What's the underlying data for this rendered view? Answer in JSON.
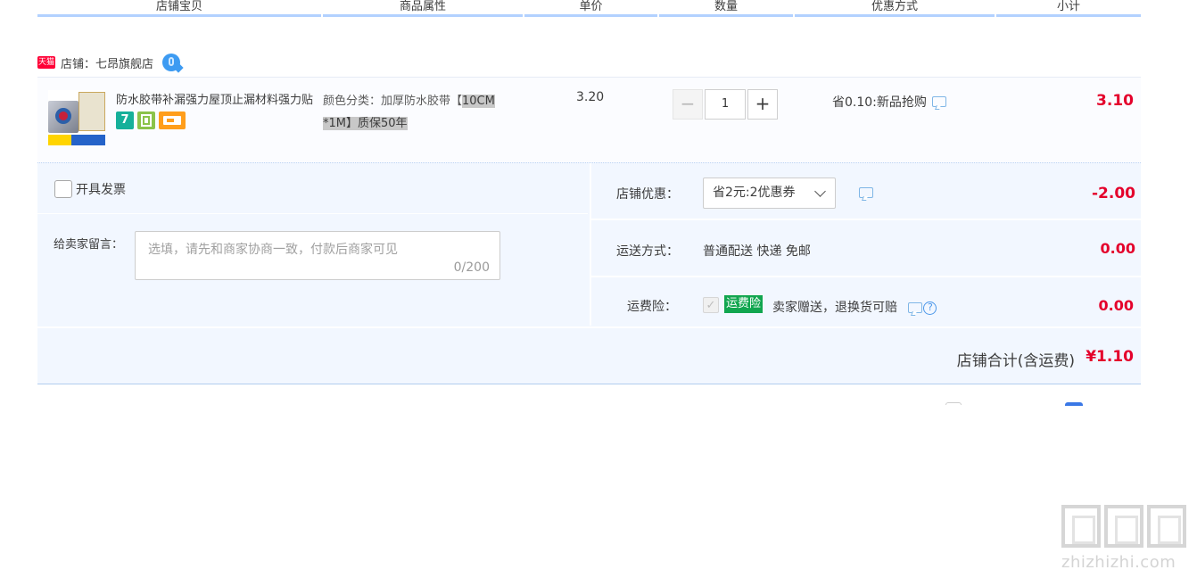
{
  "header": {
    "columns": [
      "店铺宝贝",
      "商品属性",
      "单价",
      "数量",
      "优惠方式",
      "小计"
    ]
  },
  "shop": {
    "badge": "天猫",
    "label": "店铺：七昂旗舰店"
  },
  "item": {
    "title": "防水胶带补漏强力屋顶止漏材料强力贴",
    "attr_prefix": "颜色分类：加厚防水胶带【",
    "attr_highlight_1": "10CM",
    "attr_highlight_2": "*1M】质保50年",
    "service_badge_seven": "7",
    "price": "3.20",
    "quantity": "1",
    "qty_minus": "−",
    "qty_plus": "+",
    "promo": "省0.10:新品抢购",
    "subtotal": "3.10"
  },
  "order": {
    "invoice_label": "开具发票",
    "message_label": "给卖家留言：",
    "message_placeholder": "选填，请先和商家协商一致，付款后商家可见",
    "message_count": "0/200",
    "shop_discount_label": "店铺优惠：",
    "coupon_value": "省2元:2优惠券",
    "shop_discount_amount": "-2.00",
    "shipping_label": "运送方式：",
    "shipping_value": "普通配送 快递 免邮",
    "shipping_amount": "0.00",
    "insurance_label": "运费险：",
    "insurance_tag": "运费险",
    "insurance_desc": "卖家赠送，退换货可赔",
    "insurance_help": "?",
    "insurance_amount": "0.00",
    "total_label": "店铺合计(含运费)",
    "total_value": "¥1.10"
  },
  "watermark": {
    "text": "zhizhizhi.com"
  },
  "colors": {
    "price_red": "#e4002b",
    "header_line": "#b2d1ff",
    "panel_bg": "#f2f7ff",
    "insurance_green": "#11a64f"
  },
  "icons": [
    "tmall-badge",
    "shop-chat-bubble-icon",
    "seven-day-return-icon",
    "gift-icon",
    "card-icon",
    "chat-icon",
    "chevron-down-icon",
    "check-icon",
    "help-icon"
  ]
}
